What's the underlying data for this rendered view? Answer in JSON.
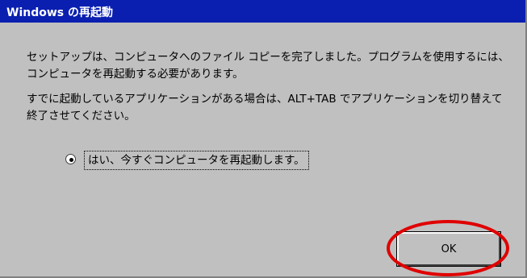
{
  "window": {
    "title": "Windows の再起動"
  },
  "message": {
    "line1": "セットアップは、コンピュータへのファイル コピーを完了しました。プログラムを使用するには、コンピュータを再起動する必要があります。",
    "line2": "すでに起動しているアプリケーションがある場合は、ALT+TAB でアプリケーションを切り替えて終了させてください。"
  },
  "option": {
    "label": "はい、今すぐコンピュータを再起動します。",
    "selected": true
  },
  "buttons": {
    "ok_label": "OK"
  },
  "colors": {
    "title_bar": "#0a1fb0",
    "dialog_face": "#c0c0c0",
    "annotation": "#e00000"
  }
}
